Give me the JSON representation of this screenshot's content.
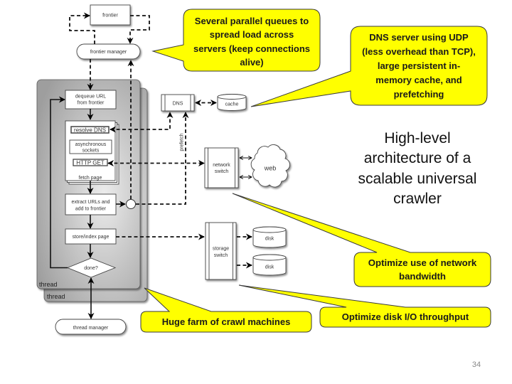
{
  "slide": {
    "page_number": "34"
  },
  "title": {
    "lines": [
      "High-level",
      "architecture of a",
      "scalable universal",
      "crawler"
    ]
  },
  "callouts": {
    "parallel_queues": {
      "lines": [
        "Several parallel queues to",
        "spread load across",
        "servers (keep connections",
        "alive)"
      ]
    },
    "dns_server": {
      "lines": [
        "DNS server using UDP",
        "(less overhead than TCP),",
        "large persistent in-",
        "memory cache, and",
        "prefetching"
      ]
    },
    "network_bandwidth": {
      "lines": [
        "Optimize use of network",
        "bandwidth"
      ]
    },
    "crawl_farm": {
      "lines": [
        "Huge farm of crawl machines"
      ]
    },
    "disk_io": {
      "lines": [
        "Optimize disk I/O throughput"
      ]
    }
  },
  "diagram": {
    "frontier": "frontier",
    "frontier_manager": "frontier manager",
    "dequeue": [
      "dequeue URL",
      "from frontier"
    ],
    "resolve_dns": "resolve DNS",
    "async_sockets": [
      "asynchronous",
      "sockets"
    ],
    "http_get": "HTTP GET",
    "fetch_page": "fetch page",
    "extract": [
      "extract URLs and",
      "add to frontier"
    ],
    "store": "store/index page",
    "done": "done?",
    "thread_labels": [
      "thread",
      "thread"
    ],
    "thread_manager": "thread manager",
    "dns": "DNS",
    "cache": "cache",
    "prefetch": "prefetch",
    "network_switch": [
      "network",
      "switch"
    ],
    "web": "web",
    "storage_switch": [
      "storage",
      "switch"
    ],
    "disks": [
      "disk",
      "disk"
    ]
  },
  "colors": {
    "callout_fill": "#ffff00",
    "callout_border": "#3a3a3a",
    "thread_panel_light": "#ececec",
    "thread_panel_dark": "#9e9e9e",
    "page_number": "#888888"
  }
}
